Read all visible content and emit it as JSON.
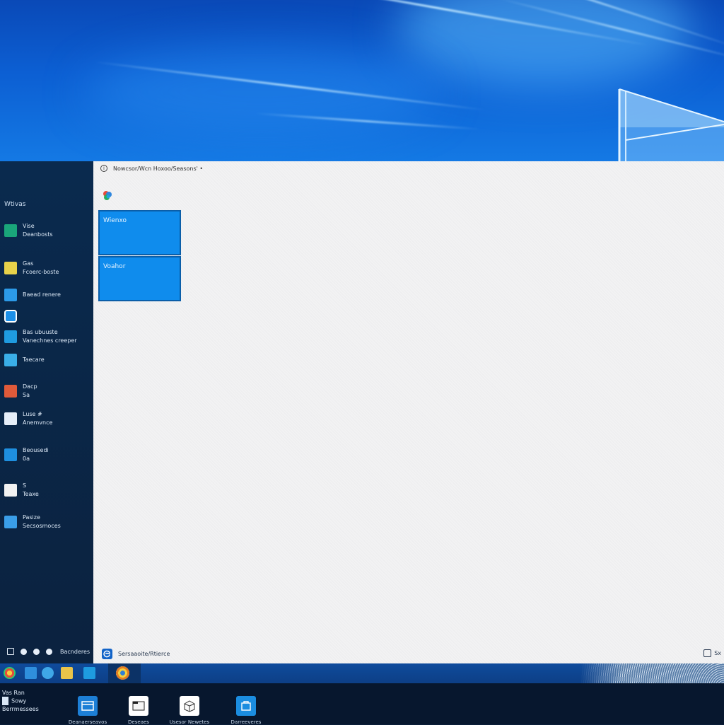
{
  "start_menu": {
    "tiles_header": "Nowcsor/Wcn Hoxoo/Seasons' •",
    "app_list_header": "Wtivas",
    "apps": [
      {
        "line1": "Vise",
        "line2": "Deanbosts",
        "icon": "store-icon",
        "color": "#1aa67a"
      },
      {
        "line1": "Gas",
        "line2": "Fcoerc-boste",
        "icon": "calendar-icon",
        "color": "#e8d24a"
      },
      {
        "line1": "Baead renere",
        "line2": "",
        "icon": "document-icon",
        "color": "#2c9ae8"
      },
      {
        "line1": "",
        "line2": "",
        "icon": "circle-app-icon",
        "color": "#1b8fe8"
      },
      {
        "line1": "Bas ubuuste",
        "line2": "Vanechnes creeper",
        "icon": "grid-app-icon",
        "color": "#1f9be0"
      },
      {
        "line1": "Taecare",
        "line2": "",
        "icon": "cloud-icon",
        "color": "#3aaee8"
      },
      {
        "line1": "Dacp",
        "line2": "Sa",
        "icon": "photos-icon",
        "color": "#e05a3a"
      },
      {
        "line1": "Luse #",
        "line2": "Anemvnce",
        "icon": "notepad-icon",
        "color": "#e6eef8"
      },
      {
        "line1": "Beousedi",
        "line2": "0a",
        "icon": "chat-icon",
        "color": "#1e8fe0"
      },
      {
        "line1": "S",
        "line2": "Teaxe",
        "icon": "text-app-icon",
        "color": "#f2f2f2"
      },
      {
        "line1": "Pasize",
        "line2": "Secsosmoces",
        "icon": "settings-app-icon",
        "color": "#3a9ee8"
      }
    ],
    "power_label": "Bacnderes",
    "tiles": [
      {
        "label": "Wienxo"
      },
      {
        "label": "Voahor"
      }
    ],
    "edge_label": "Sersaaoite/Rtierce",
    "corner_label": "Sx"
  },
  "taskbar": {
    "icons": [
      "chrome-icon",
      "file-icon",
      "edge-icon",
      "folder-icon",
      "apps-icon",
      "chrome-active-icon"
    ]
  },
  "dock": {
    "user_line1": "Vas Ran",
    "user_line2": "Sowy",
    "user_line3": "Berrmessees",
    "apps": [
      {
        "label": "Deanaerseavos",
        "icon": "window-icon"
      },
      {
        "label": "Deseaes",
        "icon": "folder-icon"
      },
      {
        "label": "Usesor Newetes",
        "icon": "box-icon"
      },
      {
        "label": "Darreeveres",
        "icon": "store-icon"
      }
    ]
  },
  "colors": {
    "accent": "#0f8ced",
    "wallpaper": "#0c5fd3",
    "start_panel": "#0b223f",
    "tiles_pane": "#f2f2f3",
    "taskbar": "#0f4b9c"
  }
}
